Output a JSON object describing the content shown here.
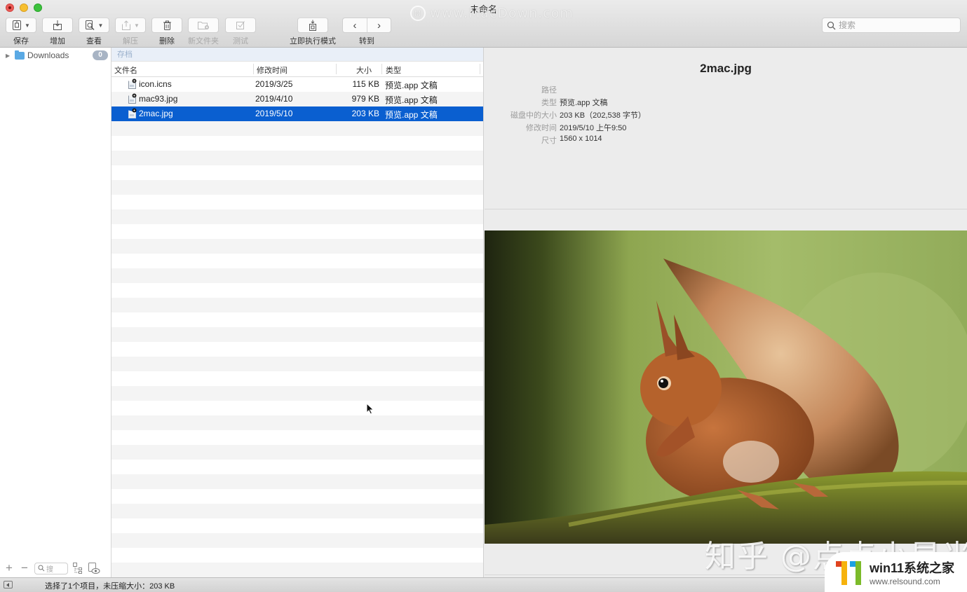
{
  "window": {
    "title": "未命名",
    "watermark": "www.MacDown.com"
  },
  "toolbar": {
    "items": [
      {
        "id": "save",
        "label": "保存",
        "icon": "archive-icon",
        "has_menu": true,
        "enabled": true
      },
      {
        "id": "add",
        "label": "增加",
        "icon": "add-to-archive-icon",
        "has_menu": false,
        "enabled": true
      },
      {
        "id": "view",
        "label": "查看",
        "icon": "quicklook-icon",
        "has_menu": true,
        "enabled": true
      },
      {
        "id": "extract",
        "label": "解压",
        "icon": "extract-icon",
        "has_menu": true,
        "enabled": false
      },
      {
        "id": "delete",
        "label": "删除",
        "icon": "trash-icon",
        "has_menu": false,
        "enabled": true
      },
      {
        "id": "new_folder",
        "label": "新文件夹",
        "icon": "new-folder-icon",
        "has_menu": false,
        "enabled": false
      },
      {
        "id": "test",
        "label": "测试",
        "icon": "checkbox-icon",
        "has_menu": false,
        "enabled": false
      },
      {
        "id": "instant",
        "label": "立即执行模式",
        "icon": "instant-mode-icon",
        "has_menu": false,
        "enabled": true
      }
    ],
    "goto": {
      "label": "转到",
      "back_icon": "chevron-left-icon",
      "forward_icon": "chevron-right-icon"
    },
    "search": {
      "placeholder": "搜索",
      "value": ""
    }
  },
  "sidebar": {
    "items": [
      {
        "label": "Downloads",
        "badge": "0",
        "icon": "folder-icon",
        "expanded": false
      }
    ],
    "bottom": {
      "add_label": "+",
      "remove_label": "−",
      "search_placeholder": "搜"
    }
  },
  "file_list": {
    "archive_label": "存档",
    "columns": [
      "文件名",
      "修改时间",
      "大小",
      "类型"
    ],
    "rows": [
      {
        "name": "icon.icns",
        "modified": "2019/3/25",
        "size": "115 KB",
        "kind": "预览.app 文稿",
        "selected": false
      },
      {
        "name": "mac93.jpg",
        "modified": "2019/4/10",
        "size": "979 KB",
        "kind": "预览.app 文稿",
        "selected": false
      },
      {
        "name": "2mac.jpg",
        "modified": "2019/5/10",
        "size": "203 KB",
        "kind": "预览.app 文稿",
        "selected": true
      }
    ]
  },
  "inspector": {
    "title": "2mac.jpg",
    "properties": [
      {
        "key": "路径",
        "value": ""
      },
      {
        "key": "类型",
        "value": "预览.app 文稿"
      },
      {
        "key": "磁盘中的大小",
        "value": "203 KB（202,538 字节）"
      },
      {
        "key": "修改时间",
        "value": "2019/5/10 上午9:50"
      },
      {
        "key": "尺寸",
        "value": "1560 x 1014"
      }
    ],
    "preview_alt": "red squirrel on mossy log"
  },
  "status": {
    "text": "选择了1个项目，未压缩大小：203 KB"
  },
  "overlays": {
    "zhihu": "知乎 @点点小星光",
    "site_title": "win11系统之家",
    "site_url": "www.relsound.com"
  },
  "colors": {
    "selection": "#0a5fd0",
    "badge": "#a8b4c4",
    "folder": "#5aa9e4"
  }
}
